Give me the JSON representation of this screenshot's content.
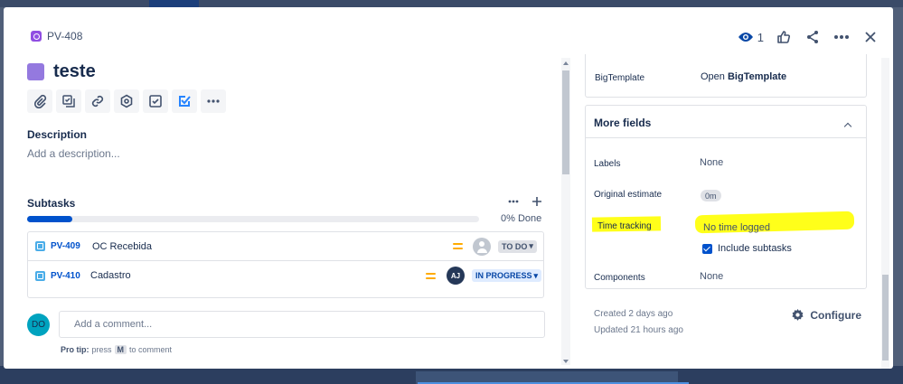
{
  "issue": {
    "key": "PV-408",
    "title": "teste"
  },
  "header": {
    "watchers_count": "1"
  },
  "description": {
    "label": "Description",
    "placeholder": "Add a description..."
  },
  "subtasks": {
    "label": "Subtasks",
    "progress_text": "0% Done",
    "progress_fraction": 0.1,
    "items": [
      {
        "key": "PV-409",
        "name": "OC Recebida",
        "status": "TO DO"
      },
      {
        "key": "PV-410",
        "name": "Cadastro",
        "status": "IN PROGRESS",
        "assignee_initials": "AJ"
      }
    ]
  },
  "comment": {
    "avatar_initials": "DO",
    "placeholder": "Add a comment...",
    "protip_label": "Pro tip:",
    "protip_pre": "press",
    "protip_key": "M",
    "protip_post": "to comment"
  },
  "details": {
    "bigtemplate_label": "BigTemplate",
    "bigtemplate_value_prefix": "Open ",
    "bigtemplate_value_bold": "BigTemplate",
    "more_fields_title": "More fields",
    "labels_label": "Labels",
    "labels_value": "None",
    "original_estimate_label": "Original estimate",
    "original_estimate_value": "0m",
    "time_tracking_label": "Time tracking",
    "time_tracking_value": "No time logged",
    "include_subtasks_label": "Include subtasks",
    "components_label": "Components",
    "components_value": "None"
  },
  "footer_meta": {
    "created": "Created 2 days ago",
    "updated": "Updated 21 hours ago",
    "configure_label": "Configure"
  },
  "colors": {
    "highlight": "#ffff1a",
    "accent": "#0052cc",
    "epic": "#904ee2",
    "priority": "#ffab00"
  }
}
